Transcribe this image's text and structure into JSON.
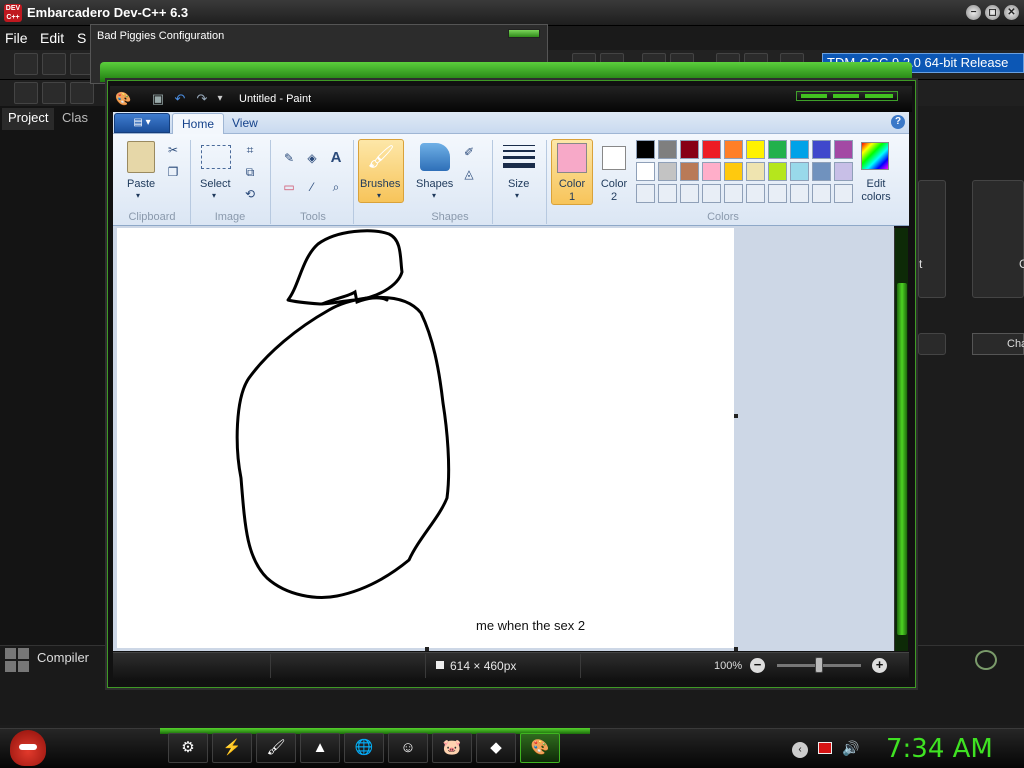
{
  "devcpp": {
    "title": "Embarcadero Dev-C++ 6.3",
    "logo_text": "DEV C++",
    "menus": [
      "File",
      "Edit",
      "S"
    ],
    "compiler_combo": "TDM-GCC 9.2.0 64-bit Release",
    "left_tabs": [
      "Project",
      "Clas"
    ],
    "bottom_tab": "Compiler",
    "right_labels": [
      "t",
      "C"
    ],
    "right_button": "Cha",
    "window_controls": [
      "−",
      "◻",
      "✕"
    ]
  },
  "badpiggies": {
    "title": "Bad Piggies Configuration"
  },
  "paint": {
    "title": "Untitled - Paint",
    "app_icon": "paint-palette-icon",
    "app_menu_glyph": "▤ ▾",
    "tabs": [
      {
        "label": "Home",
        "active": true
      },
      {
        "label": "View",
        "active": false
      }
    ],
    "help_glyph": "?",
    "groups": {
      "clipboard": {
        "label": "Clipboard",
        "paste": "Paste"
      },
      "image": {
        "label": "Image",
        "select": "Select"
      },
      "tools": {
        "label": "Tools"
      },
      "brushes": {
        "label": "Brushes"
      },
      "shapes": {
        "label": "Shapes",
        "shapes_btn": "Shapes"
      },
      "size": {
        "label": "Size"
      },
      "colors": {
        "label": "Colors",
        "color1": "Color 1",
        "color2": "Color 2",
        "edit": "Edit colors",
        "color1_value": "#f7a9c8",
        "color2_value": "#ffffff",
        "palette_row1": [
          "#000000",
          "#7f7f7f",
          "#880015",
          "#ed1c24",
          "#ff7f27",
          "#fff200",
          "#22b14c",
          "#00a2e8",
          "#3f48cc",
          "#a349a4"
        ],
        "palette_row2": [
          "#ffffff",
          "#c3c3c3",
          "#b97a57",
          "#ffaec9",
          "#ffc90e",
          "#efe4b0",
          "#b5e61d",
          "#99d9ea",
          "#7092be",
          "#c8bfe7"
        ],
        "palette_row3": [
          "#e8eef6",
          "#e8eef6",
          "#e8eef6",
          "#e8eef6",
          "#e8eef6",
          "#e8eef6",
          "#e8eef6",
          "#e8eef6",
          "#e8eef6",
          "#e8eef6"
        ]
      }
    },
    "canvas_text": "me when the sex 2",
    "status": {
      "size": "614 × 460px",
      "zoom": "100%",
      "zoom_out": "−",
      "zoom_in": "+"
    }
  },
  "taskbar": {
    "apps": [
      {
        "name": "settings-gear-icon",
        "glyph": "⚙"
      },
      {
        "name": "flash-icon",
        "glyph": "⚡"
      },
      {
        "name": "brush-app-icon",
        "glyph": "🖌"
      },
      {
        "name": "vlc-cone-icon",
        "glyph": "▲"
      },
      {
        "name": "browser-icon",
        "glyph": "🌐"
      },
      {
        "name": "smiley-icon",
        "glyph": "☺"
      },
      {
        "name": "bad-piggies-icon",
        "glyph": "🐷"
      },
      {
        "name": "devcpp-icon",
        "glyph": "◆"
      },
      {
        "name": "paint-icon",
        "glyph": "🎨"
      }
    ],
    "tray_chevron": "‹",
    "volume_glyph": "🔊",
    "clock": "7:34 AM"
  }
}
